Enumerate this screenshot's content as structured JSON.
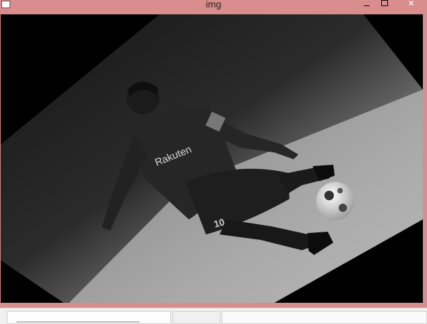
{
  "window": {
    "title": "img",
    "controls": {
      "minimize": "minimize",
      "maximize": "maximize",
      "close": "✕"
    }
  },
  "image": {
    "subject": "footballer",
    "jersey_text": "Rakuten",
    "number": "10",
    "palette": [
      "#000000",
      "#1a1a1a",
      "#2a2a2a",
      "#7a7a7a",
      "#c0c0c0"
    ]
  },
  "colors": {
    "titlebar": "#d98d8d",
    "close_glyph": "#ffffff"
  }
}
